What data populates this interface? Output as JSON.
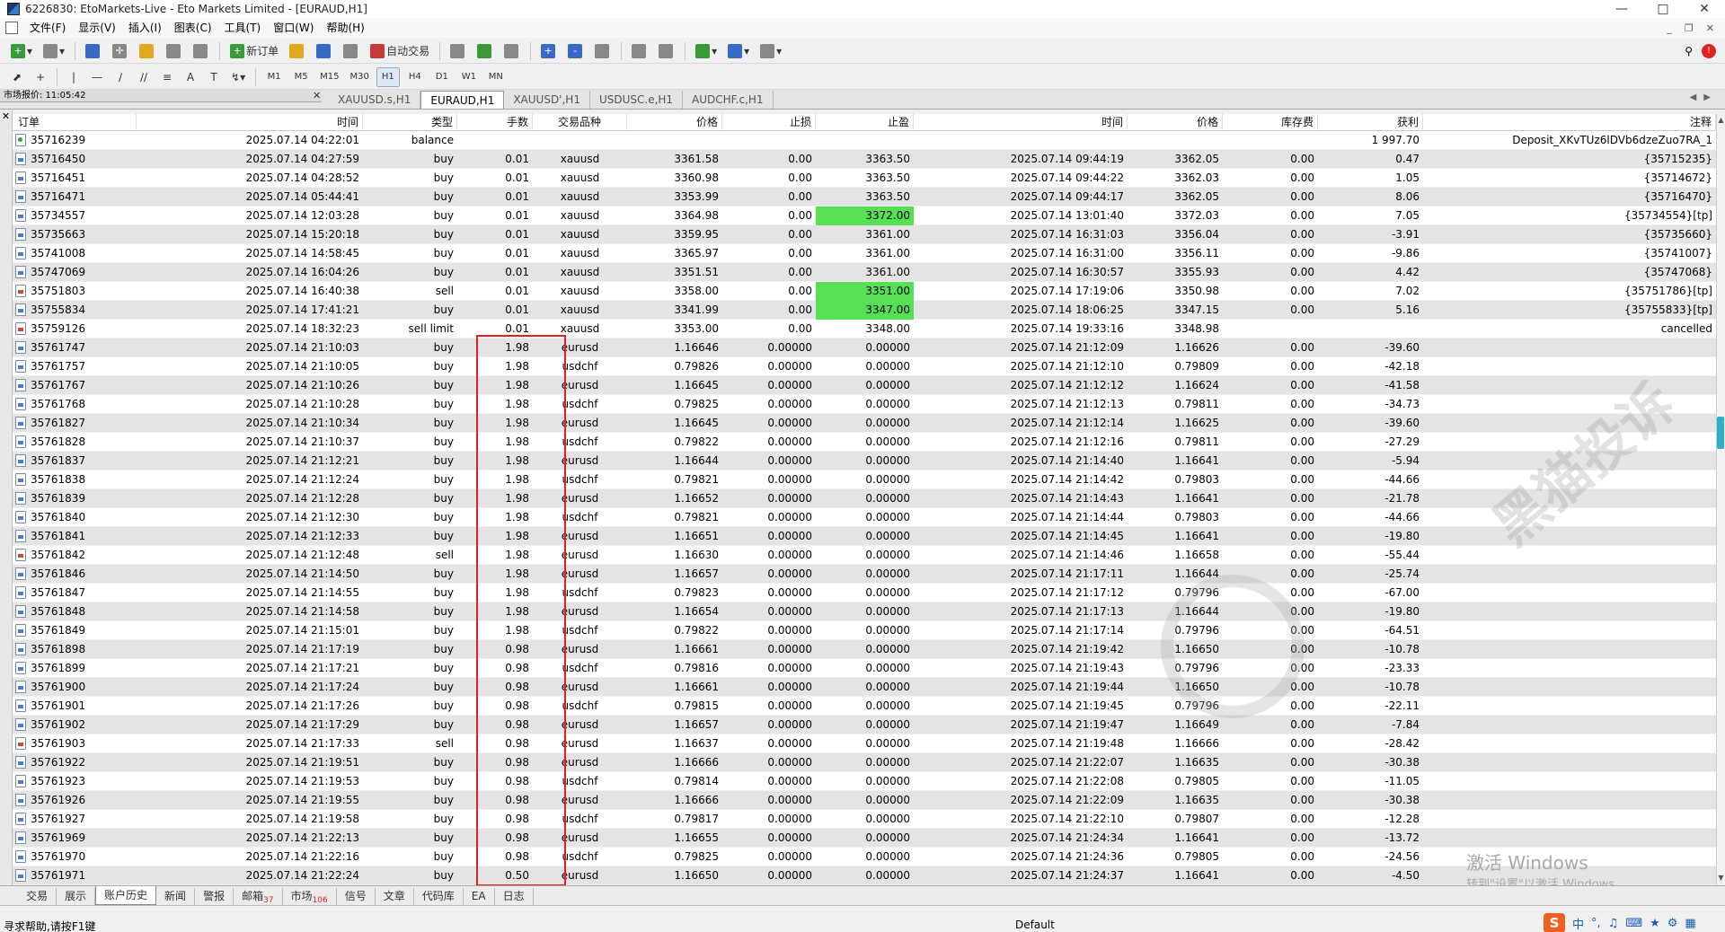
{
  "window": {
    "title": "6226830: EtoMarkets-Live - Eto Markets Limited - [EURAUD,H1]"
  },
  "menu": [
    "文件(F)",
    "显示(V)",
    "插入(I)",
    "图表(C)",
    "工具(T)",
    "窗口(W)",
    "帮助(H)"
  ],
  "toolbar": {
    "new_order": "新订单",
    "auto_trade": "自动交易",
    "timeframes": [
      "M1",
      "M5",
      "M15",
      "M30",
      "H1",
      "H4",
      "D1",
      "W1",
      "MN"
    ]
  },
  "quote_panel": {
    "label": "市场报价: 11:05:42"
  },
  "chart_tabs": [
    "XAUUSD.s,H1",
    "EURAUD,H1",
    "XAUUSD',H1",
    "USDUSC.e,H1",
    "AUDCHF.c,H1"
  ],
  "columns": [
    "订单",
    "时间",
    "类型",
    "手数",
    "交易品种",
    "价格",
    "止损",
    "止盈",
    "时间",
    "价格",
    "库存费",
    "获利",
    "注释"
  ],
  "rows": [
    [
      "35716239",
      "2025.07.14 04:22:01",
      "balance",
      "",
      "",
      "",
      "",
      "",
      "",
      "",
      "",
      "1 997.70",
      "Deposit_XKvTUz6lDVb6dzeZuo7RA_1"
    ],
    [
      "35716450",
      "2025.07.14 04:27:59",
      "buy",
      "0.01",
      "xauusd",
      "3361.58",
      "0.00",
      "3363.50",
      "2025.07.14 09:44:19",
      "3362.05",
      "0.00",
      "0.47",
      "{35715235}"
    ],
    [
      "35716451",
      "2025.07.14 04:28:52",
      "buy",
      "0.01",
      "xauusd",
      "3360.98",
      "0.00",
      "3363.50",
      "2025.07.14 09:44:22",
      "3362.03",
      "0.00",
      "1.05",
      "{35714672}"
    ],
    [
      "35716471",
      "2025.07.14 05:44:41",
      "buy",
      "0.01",
      "xauusd",
      "3353.99",
      "0.00",
      "3363.50",
      "2025.07.14 09:44:17",
      "3362.05",
      "0.00",
      "8.06",
      "{35716470}"
    ],
    [
      "35734557",
      "2025.07.14 12:03:28",
      "buy",
      "0.01",
      "xauusd",
      "3364.98",
      "0.00",
      "3372.00",
      "2025.07.14 13:01:40",
      "3372.03",
      "0.00",
      "7.05",
      "{35734554}[tp]"
    ],
    [
      "35735663",
      "2025.07.14 15:20:18",
      "buy",
      "0.01",
      "xauusd",
      "3359.95",
      "0.00",
      "3361.00",
      "2025.07.14 16:31:03",
      "3356.04",
      "0.00",
      "-3.91",
      "{35735660}"
    ],
    [
      "35741008",
      "2025.07.14 14:58:45",
      "buy",
      "0.01",
      "xauusd",
      "3365.97",
      "0.00",
      "3361.00",
      "2025.07.14 16:31:00",
      "3356.11",
      "0.00",
      "-9.86",
      "{35741007}"
    ],
    [
      "35747069",
      "2025.07.14 16:04:26",
      "buy",
      "0.01",
      "xauusd",
      "3351.51",
      "0.00",
      "3361.00",
      "2025.07.14 16:30:57",
      "3355.93",
      "0.00",
      "4.42",
      "{35747068}"
    ],
    [
      "35751803",
      "2025.07.14 16:40:38",
      "sell",
      "0.01",
      "xauusd",
      "3358.00",
      "0.00",
      "3351.00",
      "2025.07.14 17:19:06",
      "3350.98",
      "0.00",
      "7.02",
      "{35751786}[tp]"
    ],
    [
      "35755834",
      "2025.07.14 17:41:21",
      "buy",
      "0.01",
      "xauusd",
      "3341.99",
      "0.00",
      "3347.00",
      "2025.07.14 18:06:25",
      "3347.15",
      "0.00",
      "5.16",
      "{35755833}[tp]"
    ],
    [
      "35759126",
      "2025.07.14 18:32:23",
      "sell limit",
      "0.01",
      "xauusd",
      "3353.00",
      "0.00",
      "3348.00",
      "2025.07.14 19:33:16",
      "3348.98",
      "",
      "",
      "cancelled"
    ],
    [
      "35761747",
      "2025.07.14 21:10:03",
      "buy",
      "1.98",
      "eurusd",
      "1.16646",
      "0.00000",
      "0.00000",
      "2025.07.14 21:12:09",
      "1.16626",
      "0.00",
      "-39.60",
      ""
    ],
    [
      "35761757",
      "2025.07.14 21:10:05",
      "buy",
      "1.98",
      "usdchf",
      "0.79826",
      "0.00000",
      "0.00000",
      "2025.07.14 21:12:10",
      "0.79809",
      "0.00",
      "-42.18",
      ""
    ],
    [
      "35761767",
      "2025.07.14 21:10:26",
      "buy",
      "1.98",
      "eurusd",
      "1.16645",
      "0.00000",
      "0.00000",
      "2025.07.14 21:12:12",
      "1.16624",
      "0.00",
      "-41.58",
      ""
    ],
    [
      "35761768",
      "2025.07.14 21:10:28",
      "buy",
      "1.98",
      "usdchf",
      "0.79825",
      "0.00000",
      "0.00000",
      "2025.07.14 21:12:13",
      "0.79811",
      "0.00",
      "-34.73",
      ""
    ],
    [
      "35761827",
      "2025.07.14 21:10:34",
      "buy",
      "1.98",
      "eurusd",
      "1.16645",
      "0.00000",
      "0.00000",
      "2025.07.14 21:12:14",
      "1.16625",
      "0.00",
      "-39.60",
      ""
    ],
    [
      "35761828",
      "2025.07.14 21:10:37",
      "buy",
      "1.98",
      "usdchf",
      "0.79822",
      "0.00000",
      "0.00000",
      "2025.07.14 21:12:16",
      "0.79811",
      "0.00",
      "-27.29",
      ""
    ],
    [
      "35761837",
      "2025.07.14 21:12:21",
      "buy",
      "1.98",
      "eurusd",
      "1.16644",
      "0.00000",
      "0.00000",
      "2025.07.14 21:14:40",
      "1.16641",
      "0.00",
      "-5.94",
      ""
    ],
    [
      "35761838",
      "2025.07.14 21:12:24",
      "buy",
      "1.98",
      "usdchf",
      "0.79821",
      "0.00000",
      "0.00000",
      "2025.07.14 21:14:42",
      "0.79803",
      "0.00",
      "-44.66",
      ""
    ],
    [
      "35761839",
      "2025.07.14 21:12:28",
      "buy",
      "1.98",
      "eurusd",
      "1.16652",
      "0.00000",
      "0.00000",
      "2025.07.14 21:14:43",
      "1.16641",
      "0.00",
      "-21.78",
      ""
    ],
    [
      "35761840",
      "2025.07.14 21:12:30",
      "buy",
      "1.98",
      "usdchf",
      "0.79821",
      "0.00000",
      "0.00000",
      "2025.07.14 21:14:44",
      "0.79803",
      "0.00",
      "-44.66",
      ""
    ],
    [
      "35761841",
      "2025.07.14 21:12:33",
      "buy",
      "1.98",
      "eurusd",
      "1.16651",
      "0.00000",
      "0.00000",
      "2025.07.14 21:14:45",
      "1.16641",
      "0.00",
      "-19.80",
      ""
    ],
    [
      "35761842",
      "2025.07.14 21:12:48",
      "sell",
      "1.98",
      "eurusd",
      "1.16630",
      "0.00000",
      "0.00000",
      "2025.07.14 21:14:46",
      "1.16658",
      "0.00",
      "-55.44",
      ""
    ],
    [
      "35761846",
      "2025.07.14 21:14:50",
      "buy",
      "1.98",
      "eurusd",
      "1.16657",
      "0.00000",
      "0.00000",
      "2025.07.14 21:17:11",
      "1.16644",
      "0.00",
      "-25.74",
      ""
    ],
    [
      "35761847",
      "2025.07.14 21:14:55",
      "buy",
      "1.98",
      "usdchf",
      "0.79823",
      "0.00000",
      "0.00000",
      "2025.07.14 21:17:12",
      "0.79796",
      "0.00",
      "-67.00",
      ""
    ],
    [
      "35761848",
      "2025.07.14 21:14:58",
      "buy",
      "1.98",
      "eurusd",
      "1.16654",
      "0.00000",
      "0.00000",
      "2025.07.14 21:17:13",
      "1.16644",
      "0.00",
      "-19.80",
      ""
    ],
    [
      "35761849",
      "2025.07.14 21:15:01",
      "buy",
      "1.98",
      "usdchf",
      "0.79822",
      "0.00000",
      "0.00000",
      "2025.07.14 21:17:14",
      "0.79796",
      "0.00",
      "-64.51",
      ""
    ],
    [
      "35761898",
      "2025.07.14 21:17:19",
      "buy",
      "0.98",
      "eurusd",
      "1.16661",
      "0.00000",
      "0.00000",
      "2025.07.14 21:19:42",
      "1.16650",
      "0.00",
      "-10.78",
      ""
    ],
    [
      "35761899",
      "2025.07.14 21:17:21",
      "buy",
      "0.98",
      "usdchf",
      "0.79816",
      "0.00000",
      "0.00000",
      "2025.07.14 21:19:43",
      "0.79796",
      "0.00",
      "-23.33",
      ""
    ],
    [
      "35761900",
      "2025.07.14 21:17:24",
      "buy",
      "0.98",
      "eurusd",
      "1.16661",
      "0.00000",
      "0.00000",
      "2025.07.14 21:19:44",
      "1.16650",
      "0.00",
      "-10.78",
      ""
    ],
    [
      "35761901",
      "2025.07.14 21:17:26",
      "buy",
      "0.98",
      "usdchf",
      "0.79815",
      "0.00000",
      "0.00000",
      "2025.07.14 21:19:45",
      "0.79796",
      "0.00",
      "-22.11",
      ""
    ],
    [
      "35761902",
      "2025.07.14 21:17:29",
      "buy",
      "0.98",
      "eurusd",
      "1.16657",
      "0.00000",
      "0.00000",
      "2025.07.14 21:19:47",
      "1.16649",
      "0.00",
      "-7.84",
      ""
    ],
    [
      "35761903",
      "2025.07.14 21:17:33",
      "sell",
      "0.98",
      "eurusd",
      "1.16637",
      "0.00000",
      "0.00000",
      "2025.07.14 21:19:48",
      "1.16666",
      "0.00",
      "-28.42",
      ""
    ],
    [
      "35761922",
      "2025.07.14 21:19:51",
      "buy",
      "0.98",
      "eurusd",
      "1.16666",
      "0.00000",
      "0.00000",
      "2025.07.14 21:22:07",
      "1.16635",
      "0.00",
      "-30.38",
      ""
    ],
    [
      "35761923",
      "2025.07.14 21:19:53",
      "buy",
      "0.98",
      "usdchf",
      "0.79814",
      "0.00000",
      "0.00000",
      "2025.07.14 21:22:08",
      "0.79805",
      "0.00",
      "-11.05",
      ""
    ],
    [
      "35761926",
      "2025.07.14 21:19:55",
      "buy",
      "0.98",
      "eurusd",
      "1.16666",
      "0.00000",
      "0.00000",
      "2025.07.14 21:22:09",
      "1.16635",
      "0.00",
      "-30.38",
      ""
    ],
    [
      "35761927",
      "2025.07.14 21:19:58",
      "buy",
      "0.98",
      "usdchf",
      "0.79817",
      "0.00000",
      "0.00000",
      "2025.07.14 21:22:10",
      "0.79807",
      "0.00",
      "-12.28",
      ""
    ],
    [
      "35761969",
      "2025.07.14 21:22:13",
      "buy",
      "0.98",
      "eurusd",
      "1.16655",
      "0.00000",
      "0.00000",
      "2025.07.14 21:24:34",
      "1.16641",
      "0.00",
      "-13.72",
      ""
    ],
    [
      "35761970",
      "2025.07.14 21:22:16",
      "buy",
      "0.98",
      "usdchf",
      "0.79825",
      "0.00000",
      "0.00000",
      "2025.07.14 21:24:36",
      "0.79805",
      "0.00",
      "-24.56",
      ""
    ],
    [
      "35761971",
      "2025.07.14 21:22:24",
      "buy",
      "0.50",
      "eurusd",
      "1.16650",
      "0.00000",
      "0.00000",
      "2025.07.14 21:24:37",
      "1.16641",
      "0.00",
      "-4.50",
      ""
    ]
  ],
  "tp_highlight_rows": [
    4,
    8,
    9
  ],
  "highlight_color": "#55e055",
  "bottom_tabs": [
    {
      "label": "交易"
    },
    {
      "label": "展示"
    },
    {
      "label": "账户历史",
      "active": true
    },
    {
      "label": "新闻"
    },
    {
      "label": "警报"
    },
    {
      "label": "邮箱",
      "badge": "37"
    },
    {
      "label": "市场",
      "badge": "106"
    },
    {
      "label": "信号"
    },
    {
      "label": "文章"
    },
    {
      "label": "代码库"
    },
    {
      "label": "EA"
    },
    {
      "label": "日志"
    }
  ],
  "status": {
    "help": "寻求帮助,请按F1键",
    "profile": "Default"
  },
  "watermark": {
    "text": "黑猫投诉"
  },
  "activation": {
    "line1": "激活 Windows",
    "line2": "转到\"设置\"以激活 Windows。"
  },
  "tray": {
    "ime_logo": "S",
    "ime_lang": "中"
  }
}
